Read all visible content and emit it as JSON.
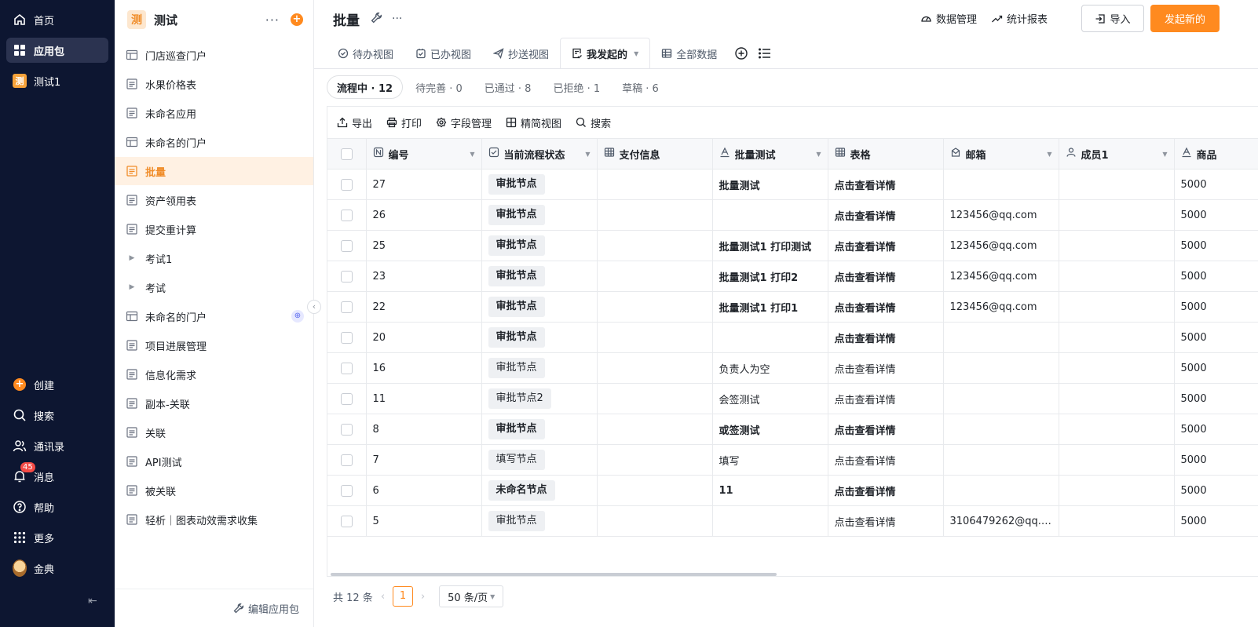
{
  "nav": {
    "items": [
      {
        "label": "首页",
        "icon": "home-icon"
      },
      {
        "label": "应用包",
        "icon": "apps-icon"
      },
      {
        "label": "测试1",
        "icon": "app-badge-icon",
        "badge": "测"
      }
    ],
    "bottom": [
      {
        "label": "创建",
        "icon": "plus-circle-icon"
      },
      {
        "label": "搜索",
        "icon": "search-icon"
      },
      {
        "label": "通讯录",
        "icon": "contacts-icon"
      },
      {
        "label": "消息",
        "icon": "bell-icon",
        "count": "45"
      },
      {
        "label": "帮助",
        "icon": "help-icon"
      },
      {
        "label": "更多",
        "icon": "grid-icon"
      },
      {
        "label": "金典",
        "icon": "avatar"
      }
    ],
    "collapse_icon": "collapse-icon"
  },
  "sidebar": {
    "logo": "测",
    "title": "测试",
    "items": [
      {
        "label": "门店巡查门户",
        "icon": "portal-icon"
      },
      {
        "label": "水果价格表",
        "icon": "form-icon"
      },
      {
        "label": "未命名应用",
        "icon": "form-icon"
      },
      {
        "label": "未命名的门户",
        "icon": "portal-icon"
      },
      {
        "label": "批量",
        "icon": "form-icon",
        "active": true
      },
      {
        "label": "资产领用表",
        "icon": "form-icon"
      },
      {
        "label": "提交重计算",
        "icon": "form-icon"
      },
      {
        "label": "考试1",
        "icon": "caret-right-icon"
      },
      {
        "label": "考试",
        "icon": "caret-right-icon"
      },
      {
        "label": "未命名的门户",
        "icon": "portal-icon",
        "globe": "⊕"
      },
      {
        "label": "项目进展管理",
        "icon": "form-icon"
      },
      {
        "label": "信息化需求",
        "icon": "form-icon"
      },
      {
        "label": "副本-关联",
        "icon": "form-icon"
      },
      {
        "label": "关联",
        "icon": "form-icon"
      },
      {
        "label": "API测试",
        "icon": "form-icon"
      },
      {
        "label": "被关联",
        "icon": "form-icon"
      },
      {
        "label": "轻析｜图表动效需求收集",
        "icon": "form-icon"
      }
    ],
    "footer_label": "编辑应用包"
  },
  "header": {
    "title": "批量",
    "actions": [
      {
        "label": "数据管理",
        "icon": "dashboard-icon"
      },
      {
        "label": "统计报表",
        "icon": "trend-icon"
      }
    ],
    "import_label": "导入",
    "start_label": "发起新的"
  },
  "tabs": [
    {
      "label": "待办视图",
      "icon": "check-circle-icon"
    },
    {
      "label": "已办视图",
      "icon": "check-square-icon"
    },
    {
      "label": "抄送视图",
      "icon": "send-icon"
    },
    {
      "label": "我发起的",
      "icon": "my-started-icon",
      "active": true
    },
    {
      "label": "全部数据",
      "icon": "table-icon"
    }
  ],
  "filters": [
    {
      "label": "流程中 · 12",
      "active": true
    },
    {
      "label": "待完善 · 0"
    },
    {
      "label": "已通过 · 8"
    },
    {
      "label": "已拒绝 · 1"
    },
    {
      "label": "草稿 · 6"
    }
  ],
  "toolbar": [
    {
      "label": "导出",
      "icon": "export-icon"
    },
    {
      "label": "打印",
      "icon": "print-icon"
    },
    {
      "label": "字段管理",
      "icon": "settings-icon"
    },
    {
      "label": "精简视图",
      "icon": "layout-icon"
    },
    {
      "label": "搜索",
      "icon": "search-icon"
    }
  ],
  "table": {
    "columns": [
      {
        "label": "编号",
        "icon": "number-icon",
        "dropdown": true
      },
      {
        "label": "当前流程状态",
        "icon": "status-icon",
        "dropdown": true
      },
      {
        "label": "支付信息",
        "icon": "table-icon",
        "dropdown": false
      },
      {
        "label": "批量测试",
        "icon": "text-icon",
        "dropdown": true
      },
      {
        "label": "表格",
        "icon": "table-icon",
        "dropdown": false
      },
      {
        "label": "邮箱",
        "icon": "mail-icon",
        "dropdown": true
      },
      {
        "label": "成员1",
        "icon": "user-icon",
        "dropdown": true
      },
      {
        "label": "商品",
        "icon": "text-icon",
        "dropdown": false
      }
    ],
    "rows": [
      {
        "id": "27",
        "status": "审批节点",
        "pay": "",
        "batch": "批量测试",
        "grid": "点击查看详情",
        "email": "",
        "member": "",
        "goods": "5000",
        "bold": true
      },
      {
        "id": "26",
        "status": "审批节点",
        "pay": "",
        "batch": "",
        "grid": "点击查看详情",
        "email": "123456@qq.com",
        "member": "",
        "goods": "5000",
        "bold": true
      },
      {
        "id": "25",
        "status": "审批节点",
        "pay": "",
        "batch": "批量测试1 打印测试",
        "grid": "点击查看详情",
        "email": "123456@qq.com",
        "member": "",
        "goods": "5000",
        "bold": true
      },
      {
        "id": "23",
        "status": "审批节点",
        "pay": "",
        "batch": "批量测试1 打印2",
        "grid": "点击查看详情",
        "email": "123456@qq.com",
        "member": "",
        "goods": "5000",
        "bold": true
      },
      {
        "id": "22",
        "status": "审批节点",
        "pay": "",
        "batch": "批量测试1 打印1",
        "grid": "点击查看详情",
        "email": "123456@qq.com",
        "member": "",
        "goods": "5000",
        "bold": true
      },
      {
        "id": "20",
        "status": "审批节点",
        "pay": "",
        "batch": "",
        "grid": "点击查看详情",
        "email": "",
        "member": "",
        "goods": "5000",
        "bold": true
      },
      {
        "id": "16",
        "status": "审批节点",
        "pay": "",
        "batch": "负责人为空",
        "grid": "点击查看详情",
        "email": "",
        "member": "",
        "goods": "5000",
        "bold": false
      },
      {
        "id": "11",
        "status": "审批节点2",
        "pay": "",
        "batch": "会签测试",
        "grid": "点击查看详情",
        "email": "",
        "member": "",
        "goods": "5000",
        "bold": false
      },
      {
        "id": "8",
        "status": "审批节点",
        "pay": "",
        "batch": "或签测试",
        "grid": "点击查看详情",
        "email": "",
        "member": "",
        "goods": "5000",
        "bold": true
      },
      {
        "id": "7",
        "status": "填写节点",
        "pay": "",
        "batch": "填写",
        "grid": "点击查看详情",
        "email": "",
        "member": "",
        "goods": "5000",
        "bold": false
      },
      {
        "id": "6",
        "status": "未命名节点",
        "pay": "",
        "batch": "11",
        "grid": "点击查看详情",
        "email": "",
        "member": "",
        "goods": "5000",
        "bold": true
      },
      {
        "id": "5",
        "status": "审批节点",
        "pay": "",
        "batch": "",
        "grid": "点击查看详情",
        "email": "3106479262@qq.c...",
        "member": "",
        "goods": "5000",
        "bold": false
      }
    ]
  },
  "pager": {
    "total": "共 12 条",
    "prev": "‹",
    "current": "1",
    "next": "›",
    "size": "50 条/页"
  },
  "colors": {
    "accent": "#ff8a1f",
    "nav_bg": "#0d1631",
    "active_bg": "#fff1e3"
  }
}
